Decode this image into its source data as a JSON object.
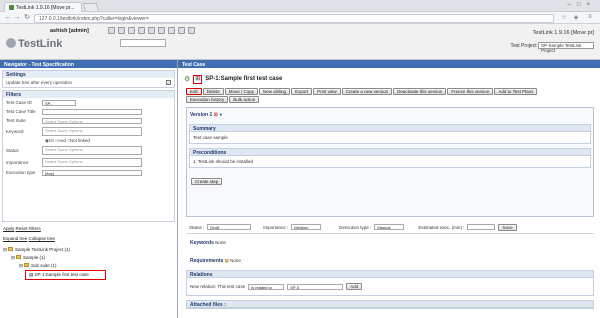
{
  "browser": {
    "tab_title": "TestLink 1.9.16 [Move pr...",
    "tab_extra": "TestLink - Microsoft Edge",
    "url": "127.0.0.1/testlink/index.php?caller=login&viewer="
  },
  "header": {
    "logo": "TestLink",
    "user": "ashish [admin]",
    "version": "TestLink 1.9.16 [Move pr]",
    "project_label": "Test Project",
    "project_value": "SP-Sample TestLink Project"
  },
  "left": {
    "title": "Navigator - Test Specification",
    "settings": {
      "title": "Settings",
      "option": "Update tree after every operation"
    },
    "filters": {
      "title": "Filters",
      "fields": [
        {
          "label": "Test Case ID",
          "value": "SP-"
        },
        {
          "label": "Test Case Title",
          "value": ""
        },
        {
          "label": "Test Suite",
          "value": "Select Some Options"
        },
        {
          "label": "Keyword",
          "value": "Select Some Options"
        },
        {
          "label": "Status",
          "value": "Select Some Options"
        },
        {
          "label": "Importance",
          "value": "Select Some Options"
        },
        {
          "label": "Execution type",
          "value": "[Any]"
        }
      ],
      "radio_or": "Or",
      "radio_and": "And",
      "radio_not": "Not linked"
    },
    "actions": {
      "apply": "Apply",
      "reset": "Reset Filters",
      "expand": "Expand tree",
      "collapse": "Collapse tree"
    },
    "tree": [
      "Sample TestLink Project (1)",
      "Sample (1)",
      "Sub suite (1)",
      "SP-1:Sample first test case"
    ]
  },
  "right": {
    "title": "Test Case",
    "tc_title": "SP-1:Sample first test case",
    "buttons": [
      "Edit",
      "Delete",
      "Move / Copy",
      "New sibling",
      "Export",
      "Print view",
      "Create a new version",
      "Deactivate this version",
      "Freeze this version",
      "Add to Test Plans"
    ],
    "buttons2": [
      "Execution history",
      "Bulk action"
    ],
    "version_label": "Version 1",
    "summary_label": "Summary",
    "summary_text": "Test case sample",
    "precond_label": "Preconditions",
    "precond_text": "1. TestLink should be installed",
    "create_steps": "Create step",
    "status_label": "Status :",
    "status_value": "Draft",
    "importance_label": "Importance :",
    "importance_value": "Medium",
    "exec_type_label": "Execution type :",
    "exec_type_value": "Manual",
    "est_label": "Estimated exec. (min) :",
    "save_label": "Save",
    "keywords_label": "Keywords",
    "keywords_value": "None",
    "req_label": "Requirements",
    "req_value": "None",
    "relations_label": "Relations",
    "relation_text": "New relation: This test case",
    "relation_select": "is related to",
    "relation_input": "SP-5",
    "add_label": "Add",
    "attached_label": "Attached files :"
  }
}
